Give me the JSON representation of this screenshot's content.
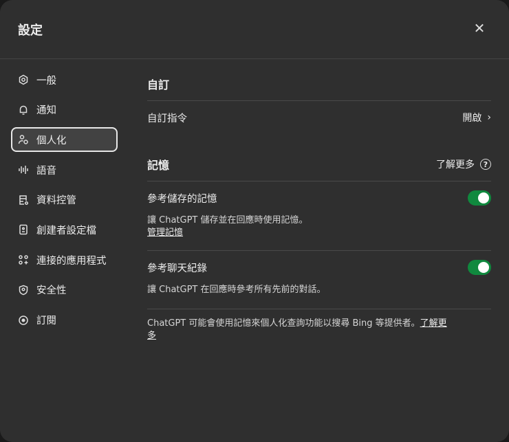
{
  "header": {
    "title": "設定",
    "close_icon": "close-icon"
  },
  "sidebar": {
    "items": [
      {
        "label": "一般",
        "icon": "gear-icon"
      },
      {
        "label": "通知",
        "icon": "bell-icon"
      },
      {
        "label": "個人化",
        "icon": "person-icon",
        "active": true
      },
      {
        "label": "語音",
        "icon": "waveform-icon"
      },
      {
        "label": "資料控管",
        "icon": "database-icon"
      },
      {
        "label": "創建者設定檔",
        "icon": "id-badge-icon"
      },
      {
        "label": "連接的應用程式",
        "icon": "apps-icon"
      },
      {
        "label": "安全性",
        "icon": "shield-icon"
      },
      {
        "label": "訂閱",
        "icon": "subscription-icon"
      }
    ]
  },
  "main": {
    "custom": {
      "title": "自訂",
      "instructions_label": "自訂指令",
      "instructions_value": "開啟"
    },
    "memory": {
      "title": "記憶",
      "learn_more": "了解更多",
      "saved": {
        "label": "參考儲存的記憶",
        "on": true,
        "desc": "讓 ChatGPT 儲存並在回應時使用記憶。",
        "manage": "管理記憶"
      },
      "history": {
        "label": "參考聊天紀錄",
        "on": true,
        "desc": "讓 ChatGPT 在回應時參考所有先前的對話。"
      },
      "footer": "ChatGPT 可能會使用記憶來個人化查詢功能以搜尋 Bing 等提供者。",
      "footer_link": "了解更多"
    }
  },
  "colors": {
    "background": "#2f2f2f",
    "toggle_on": "#10893e"
  }
}
